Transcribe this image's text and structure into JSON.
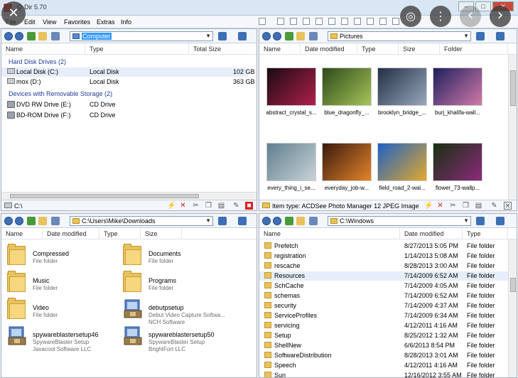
{
  "app": {
    "title": "Q-Dir 5.70"
  },
  "menu": [
    "File",
    "Edit",
    "View",
    "Favorites",
    "Extras",
    "Info"
  ],
  "overlay": {
    "close": "✕",
    "lens": "◎",
    "more": "⋮",
    "prev": "‹",
    "next": "›"
  },
  "pane_tl": {
    "address": "Computer",
    "columns": [
      "Name",
      "Type",
      "Total Size"
    ],
    "groups": [
      {
        "label": "Hard Disk Drives (2)",
        "items": [
          {
            "name": "Local Disk (C:)",
            "type": "Local Disk",
            "size": "102 GB",
            "icon": "hard-disk-icon"
          },
          {
            "name": "mox (D:)",
            "type": "Local Disk",
            "size": "363 GB",
            "icon": "hard-disk-icon"
          }
        ]
      },
      {
        "label": "Devices with Removable Storage (2)",
        "items": [
          {
            "name": "DVD RW Drive (E:)",
            "type": "CD Drive",
            "size": "",
            "icon": "cd-drive-icon"
          },
          {
            "name": "BD-ROM Drive (F:)",
            "type": "CD Drive",
            "size": "",
            "icon": "cd-drive-icon"
          }
        ]
      }
    ],
    "status": "C:\\"
  },
  "pane_tr": {
    "address": "Pictures",
    "columns": [
      "Name",
      "Date modified",
      "Type",
      "Size",
      "Folder"
    ],
    "thumbs": [
      {
        "caption": "abstract_crystal_s...",
        "colors": [
          "#1a0a14",
          "#b0204a"
        ]
      },
      {
        "caption": "blue_dragonfly_...",
        "colors": [
          "#2e4a1a",
          "#a6c45a"
        ]
      },
      {
        "caption": "brooklyn_bridge_...",
        "colors": [
          "#223046",
          "#9aa8bc"
        ]
      },
      {
        "caption": "burj_khalifa-wall...",
        "colors": [
          "#1d1f5e",
          "#d27aa8"
        ]
      },
      {
        "caption": "every_thing_i_se...",
        "colors": [
          "#5f7f8f",
          "#c9d3d6"
        ]
      },
      {
        "caption": "everyday_job-w...",
        "colors": [
          "#3a1a0e",
          "#e4842a"
        ]
      },
      {
        "caption": "field_road_2-wal...",
        "colors": [
          "#1e62c4",
          "#e2a82c"
        ]
      },
      {
        "caption": "flower_73-wallp...",
        "colors": [
          "#183010",
          "#8a2a7a"
        ]
      }
    ],
    "status": "Item type: ACDSee Photo Manager 12 JPEG Image Rati"
  },
  "pane_bl": {
    "address": "C:\\Users\\Mike\\Downloads",
    "columns": [
      "Name",
      "Date modified",
      "Type",
      "Size"
    ],
    "tiles": [
      {
        "name": "Compressed",
        "sub1": "File folder",
        "sub2": "",
        "kind": "folder"
      },
      {
        "name": "Documents",
        "sub1": "File folder",
        "sub2": "",
        "kind": "folder"
      },
      {
        "name": "Music",
        "sub1": "File folder",
        "sub2": "",
        "kind": "folder"
      },
      {
        "name": "Programs",
        "sub1": "File folder",
        "sub2": "",
        "kind": "folder"
      },
      {
        "name": "Video",
        "sub1": "File folder",
        "sub2": "",
        "kind": "folder"
      },
      {
        "name": "debutpsetup",
        "sub1": "Debut Video Capture Softwa...",
        "sub2": "NCH Software",
        "kind": "installer"
      },
      {
        "name": "spywareblastersetup46",
        "sub1": "SpywareBlaster Setup",
        "sub2": "Javacool Software LLC",
        "kind": "installer"
      },
      {
        "name": "spywareblastersetup50",
        "sub1": "SpywareBlaster Setup",
        "sub2": "BrightFort LLC",
        "kind": "installer"
      }
    ]
  },
  "pane_br": {
    "address": "C:\\Windows",
    "columns": [
      "Name",
      "Date modified",
      "Type"
    ],
    "rows": [
      {
        "name": "Prefetch",
        "date": "8/27/2013 5:05 PM",
        "type": "File folder"
      },
      {
        "name": "registration",
        "date": "1/14/2013 5:08 AM",
        "type": "File folder"
      },
      {
        "name": "rescache",
        "date": "8/28/2013 3:00 AM",
        "type": "File folder"
      },
      {
        "name": "Resources",
        "date": "7/14/2009 6:52 AM",
        "type": "File folder"
      },
      {
        "name": "SchCache",
        "date": "7/14/2009 4:05 AM",
        "type": "File folder"
      },
      {
        "name": "schemas",
        "date": "7/14/2009 6:52 AM",
        "type": "File folder"
      },
      {
        "name": "security",
        "date": "7/14/2009 4:37 AM",
        "type": "File folder"
      },
      {
        "name": "ServiceProfiles",
        "date": "7/14/2009 6:34 AM",
        "type": "File folder"
      },
      {
        "name": "servicing",
        "date": "4/12/2011 4:16 AM",
        "type": "File folder"
      },
      {
        "name": "Setup",
        "date": "8/25/2012 1:32 AM",
        "type": "File folder"
      },
      {
        "name": "ShellNew",
        "date": "6/6/2013 8:54 PM",
        "type": "File folder"
      },
      {
        "name": "SoftwareDistribution",
        "date": "8/28/2013 3:01 AM",
        "type": "File folder"
      },
      {
        "name": "Speech",
        "date": "4/12/2011 4:16 AM",
        "type": "File folder"
      },
      {
        "name": "Sun",
        "date": "12/16/2012 3:55 AM",
        "type": "File folder"
      }
    ]
  }
}
